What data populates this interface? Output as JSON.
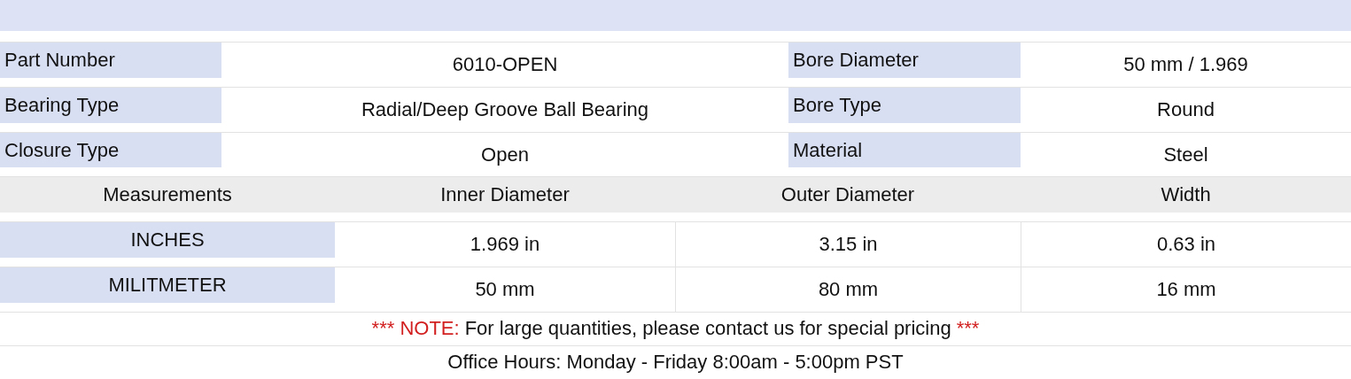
{
  "specs": [
    {
      "label": "Part Number",
      "value": "6010-OPEN",
      "label_2": "Bore Diameter",
      "value_2": "50 mm / 1.969"
    },
    {
      "label": "Bearing Type",
      "value": "Radial/Deep Groove Ball Bearing",
      "label_2": "Bore Type",
      "value_2": "Round"
    },
    {
      "label": "Closure Type",
      "value": "Open",
      "label_2": "Material",
      "value_2": "Steel"
    }
  ],
  "measurements": {
    "columns": [
      "Measurements",
      "Inner Diameter",
      "Outer Diameter",
      "Width"
    ],
    "rows": [
      {
        "unit": "INCHES",
        "values": [
          "1.969 in",
          "3.15 in",
          "0.63 in"
        ]
      },
      {
        "unit": "MILITMETER",
        "values": [
          "50 mm",
          "80 mm",
          "16 mm"
        ]
      }
    ]
  },
  "note": {
    "prefix": "*** NOTE:",
    "text": "For large quantities, please contact us for special pricing",
    "suffix": "***"
  },
  "office_hours": "Office Hours: Monday - Friday 8:00am - 5:00pm PST"
}
